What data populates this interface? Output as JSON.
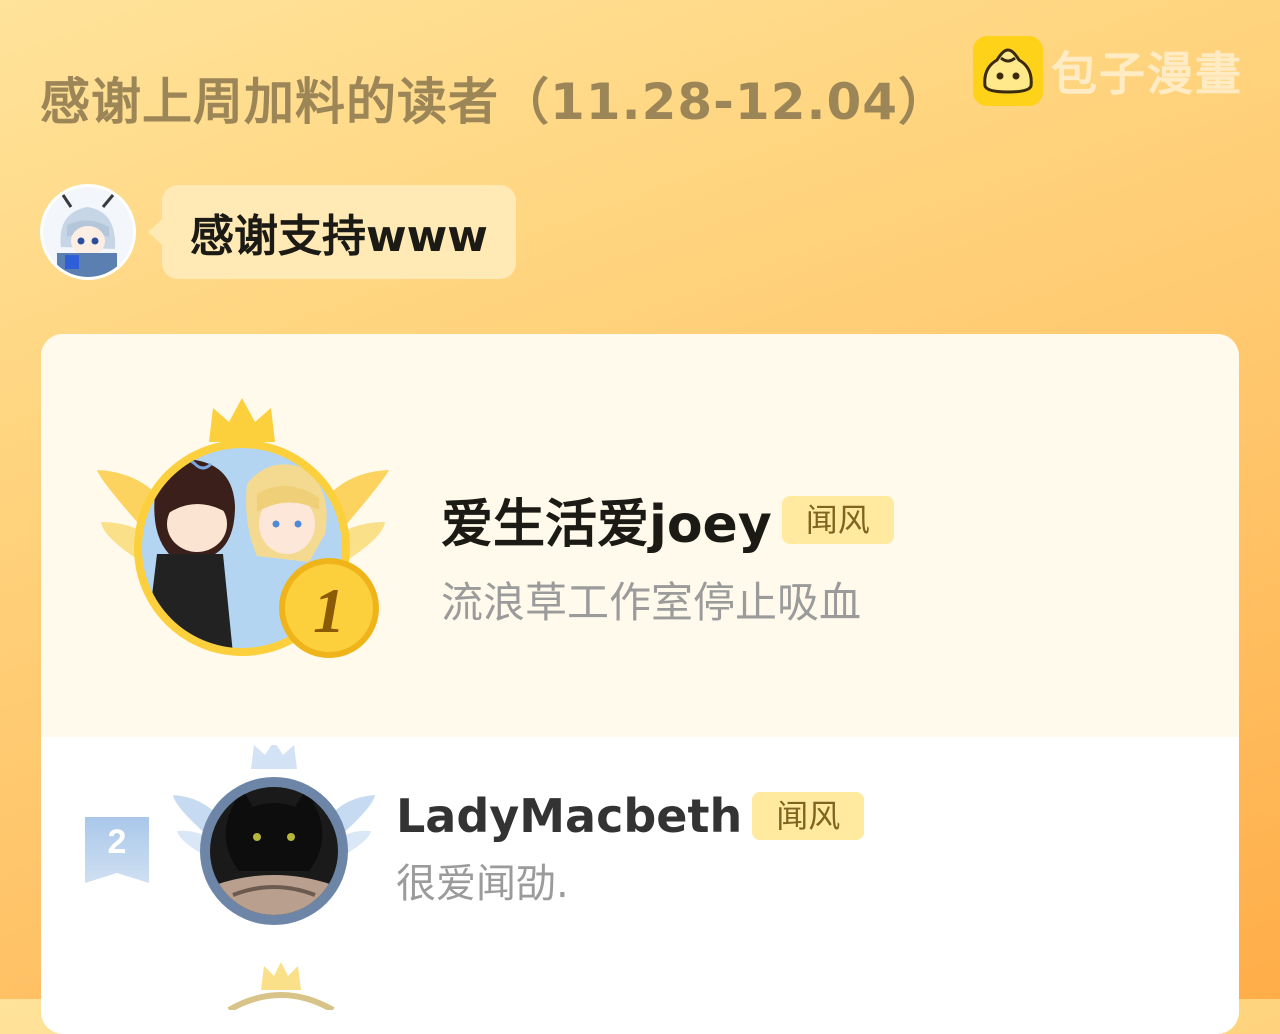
{
  "header": {
    "title": "感谢上周加料的读者（11.28-12.04）",
    "brand_name": "包子漫畫",
    "brand_icon": "baozi-bun-icon"
  },
  "thanks_message": {
    "text": "感谢支持www"
  },
  "ranking": [
    {
      "rank": "1",
      "name": "爱生活爱joey",
      "tag": "闻风",
      "message": "流浪草工作室停止吸血"
    },
    {
      "rank": "2",
      "name": "LadyMacbeth",
      "tag": "闻风",
      "message": "很爱闻劭."
    }
  ],
  "colors": {
    "background_top": "#ffe39a",
    "background_bottom": "#ffad48",
    "title": "#9c8658",
    "gold": "#ffcc33",
    "silver_blue": "#a9c7ea",
    "tag_bg": "#ffeaa0"
  }
}
